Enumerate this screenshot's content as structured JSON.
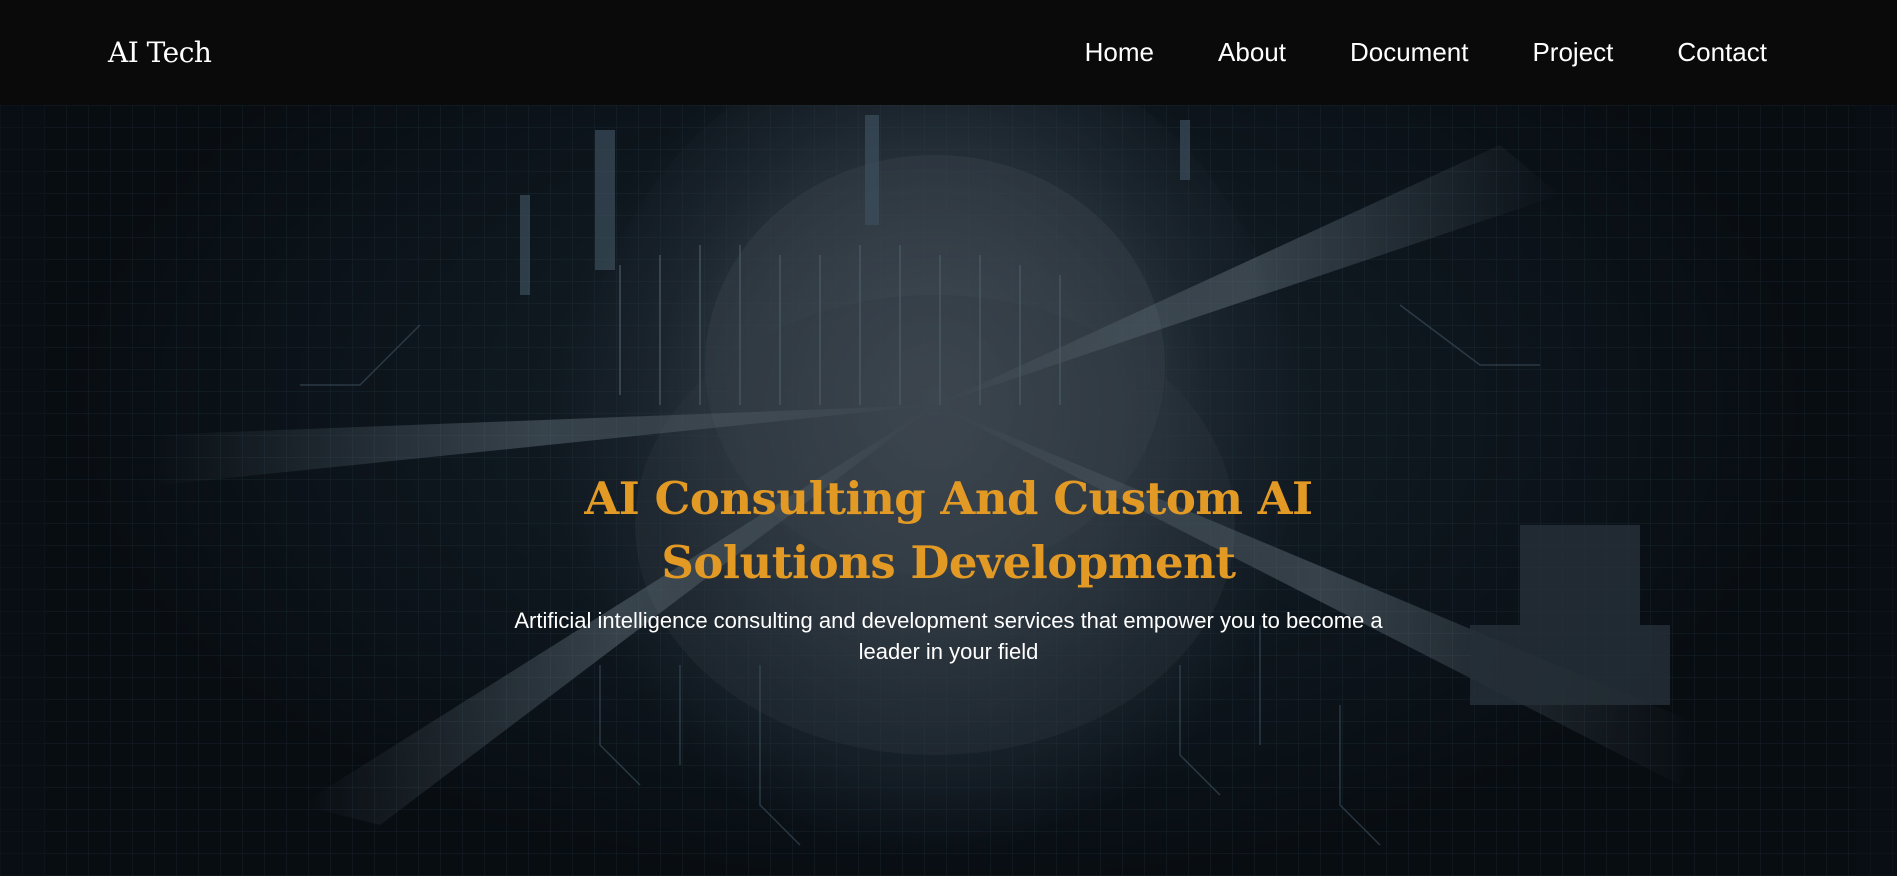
{
  "navbar": {
    "brand": "AI Tech",
    "links": [
      "Home",
      "About",
      "Document",
      "Project",
      "Contact"
    ]
  },
  "hero": {
    "background_image": "ai-head-digital-illustration",
    "title": "AI Consulting And Custom AI Solutions Development",
    "subtitle": "Artificial intelligence consulting and development services that empower you to become a leader in your field"
  },
  "colors": {
    "navbar_bg": "#0a0a0a",
    "title_accent": "#e39a25",
    "text": "#ffffff"
  }
}
